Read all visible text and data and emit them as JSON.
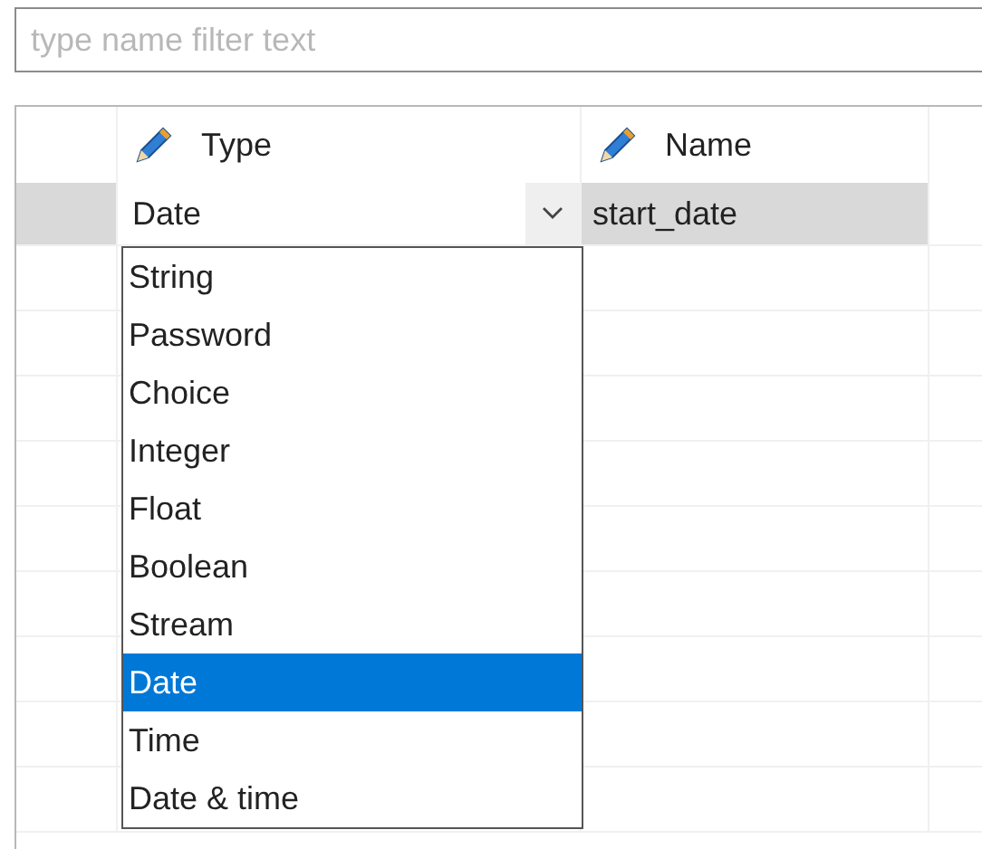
{
  "filter": {
    "placeholder": "type name filter text"
  },
  "table": {
    "columns": [
      {
        "label": "Type",
        "editable": true
      },
      {
        "label": "Name",
        "editable": true
      }
    ],
    "rows": [
      {
        "type": "Date",
        "name": "start_date",
        "selected": true
      }
    ]
  },
  "dropdown": {
    "options": [
      {
        "label": "String",
        "selected": false
      },
      {
        "label": "Password",
        "selected": false
      },
      {
        "label": "Choice",
        "selected": false
      },
      {
        "label": "Integer",
        "selected": false
      },
      {
        "label": "Float",
        "selected": false
      },
      {
        "label": "Boolean",
        "selected": false
      },
      {
        "label": "Stream",
        "selected": false
      },
      {
        "label": "Date",
        "selected": true
      },
      {
        "label": "Time",
        "selected": false
      },
      {
        "label": "Date & time",
        "selected": false
      }
    ]
  }
}
